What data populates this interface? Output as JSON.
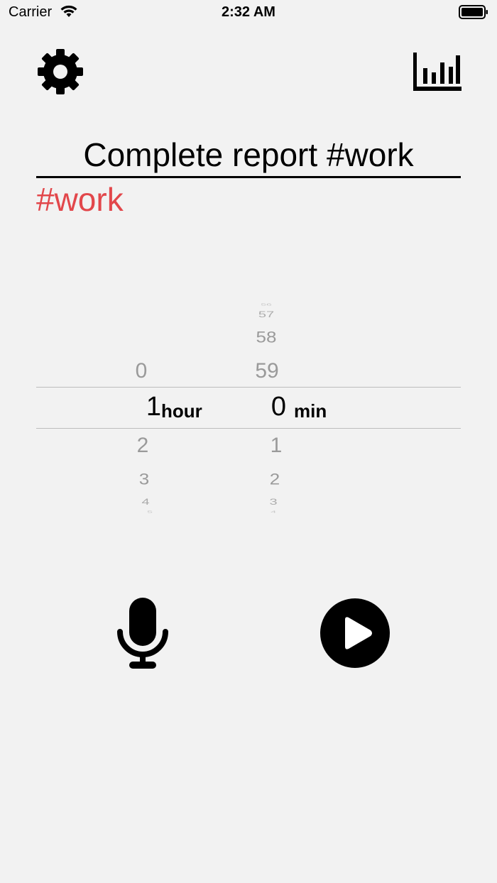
{
  "status_bar": {
    "carrier": "Carrier",
    "time": "2:32 AM"
  },
  "task": {
    "text": "Complete report #work",
    "tag": "#work"
  },
  "picker": {
    "hours": {
      "above": [
        "0"
      ],
      "selected": "1",
      "below": [
        "2",
        "3",
        "4",
        "5"
      ],
      "unit": "hour"
    },
    "minutes": {
      "above": [
        "56",
        "57",
        "58",
        "59"
      ],
      "selected": "0",
      "below": [
        "1",
        "2",
        "3",
        "4"
      ],
      "unit": "min"
    }
  },
  "icons": {
    "settings": "gear-icon",
    "stats": "bar-chart-icon",
    "mic": "microphone-icon",
    "play": "play-circle-icon"
  },
  "colors": {
    "tag": "#e2474b",
    "background": "#f2f2f2"
  }
}
